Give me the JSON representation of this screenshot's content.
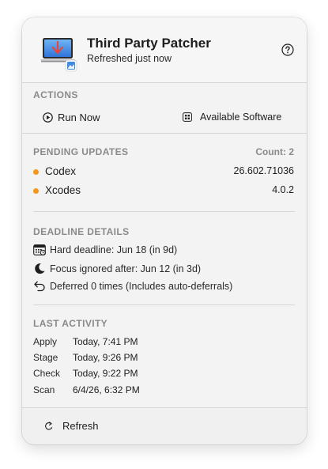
{
  "header": {
    "title": "Third Party Patcher",
    "subtitle": "Refreshed just now"
  },
  "actions": {
    "section_title": "ACTIONS",
    "run_now_label": "Run Now",
    "available_software_label": "Available Software"
  },
  "pending": {
    "section_title": "PENDING UPDATES",
    "count_label": "Count: 2",
    "items": [
      {
        "name": "Codex",
        "version": "26.602.71036"
      },
      {
        "name": "Xcodes",
        "version": "4.0.2"
      }
    ]
  },
  "deadline": {
    "section_title": "DEADLINE DETAILS",
    "hard_deadline": "Hard deadline: Jun 18 (in 9d)",
    "focus_ignored": "Focus ignored after: Jun 12 (in 3d)",
    "deferred": "Deferred 0 times (Includes auto-deferrals)"
  },
  "last_activity": {
    "section_title": "LAST ACTIVITY",
    "rows": [
      {
        "label": "Apply",
        "value": "Today, 7:41 PM"
      },
      {
        "label": "Stage",
        "value": "Today, 9:26 PM"
      },
      {
        "label": "Check",
        "value": "Today, 9:22 PM"
      },
      {
        "label": "Scan",
        "value": "6/4/26, 6:32 PM"
      }
    ]
  },
  "footer": {
    "refresh_label": "Refresh"
  },
  "colors": {
    "status_dot": "#f5961d",
    "section_title": "#8a8a8a",
    "download_arrow": "#e8473a"
  },
  "icons": {
    "app": "laptop-download-icon",
    "help": "question-circle-icon",
    "run_now": "play-circle-icon",
    "available_software": "grid-box-icon",
    "hard_deadline": "calendar-icon",
    "focus": "moon-icon",
    "deferred": "undo-arrow-icon",
    "refresh": "refresh-icon"
  }
}
